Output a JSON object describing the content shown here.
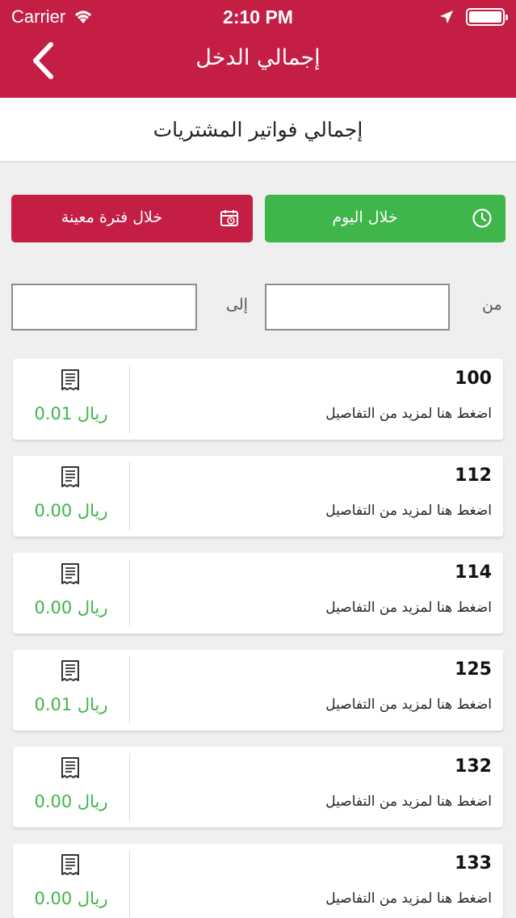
{
  "status": {
    "carrier": "Carrier",
    "time": "2:10 PM"
  },
  "nav": {
    "title": "إجمالي الدخل"
  },
  "subheader": {
    "title": "إجمالي فواتير المشتريات"
  },
  "filters": {
    "today_label": "خلال اليوم",
    "period_label": "خلال فترة معينة",
    "from_label": "من",
    "to_label": "إلى",
    "from_value": "",
    "to_value": ""
  },
  "invoices": [
    {
      "number": "100",
      "details": "اضغط هنا لمزيد من التفاصيل",
      "amount": "0.01 ريال"
    },
    {
      "number": "112",
      "details": "اضغط هنا لمزيد من التفاصيل",
      "amount": "0.00 ريال"
    },
    {
      "number": "114",
      "details": "اضغط هنا لمزيد من التفاصيل",
      "amount": "0.00 ريال"
    },
    {
      "number": "125",
      "details": "اضغط هنا لمزيد من التفاصيل",
      "amount": "0.01 ريال"
    },
    {
      "number": "132",
      "details": "اضغط هنا لمزيد من التفاصيل",
      "amount": "0.00 ريال"
    },
    {
      "number": "133",
      "details": "اضغط هنا لمزيد من التفاصيل",
      "amount": "0.00 ريال"
    }
  ],
  "colors": {
    "brand": "#c41e45",
    "accent_green": "#3fb54a"
  },
  "icons": {
    "back": "chevron-left-icon",
    "today": "clock-icon",
    "period": "calendar-clock-icon",
    "receipt": "receipt-icon"
  }
}
